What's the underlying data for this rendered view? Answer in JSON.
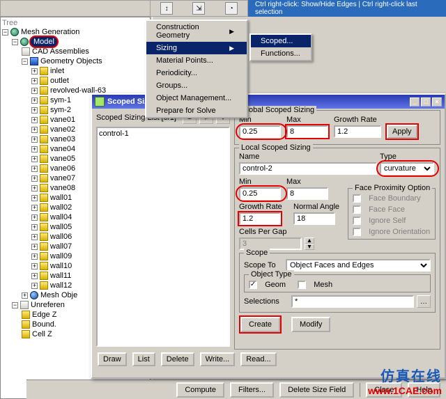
{
  "toolbar": {
    "hint": "Ctrl right-click: Show/Hide Edges | Ctrl right-click last selection"
  },
  "tree": {
    "title": "Tree",
    "root": "Mesh Generation",
    "model": "Model",
    "cad": "CAD Assemblies",
    "geom": "Geometry Objects",
    "items": [
      "inlet",
      "outlet",
      "revolved-wall-63",
      "sym-1",
      "sym-2",
      "vane01",
      "vane02",
      "vane03",
      "vane04",
      "vane05",
      "vane06",
      "vane07",
      "vane08",
      "wall01",
      "wall02",
      "wall04",
      "wall05",
      "wall06",
      "wall07",
      "wall09",
      "wall10",
      "wall11",
      "wall12"
    ],
    "mesh_obj": "Mesh Obje",
    "unref": "Unreferen",
    "unref_items": [
      "Edge Z",
      "Bound.",
      "Cell Z"
    ]
  },
  "ctx": {
    "items": [
      {
        "label": "Construction Geometry",
        "arrow": true
      },
      {
        "label": "Sizing",
        "arrow": true,
        "hi": true
      },
      {
        "label": "Material Points..."
      },
      {
        "label": "Periodicity..."
      },
      {
        "label": "Groups..."
      },
      {
        "label": "Object Management..."
      },
      {
        "label": "Prepare for Solve"
      }
    ],
    "sub": [
      {
        "label": "Scoped...",
        "hi": true
      },
      {
        "label": "Functions..."
      }
    ]
  },
  "dialog": {
    "title": "Scoped Sizing",
    "list_header": "Scoped Sizing List [0/1]",
    "list_items": [
      "control-1"
    ],
    "global": {
      "legend": "Global Scoped Sizing",
      "min_lbl": "Min",
      "min": "0.25",
      "max_lbl": "Max",
      "max": "8",
      "gr_lbl": "Growth Rate",
      "gr": "1.2",
      "apply": "Apply"
    },
    "local": {
      "legend": "Local Scoped Sizing",
      "name_lbl": "Name",
      "name": "control-2",
      "type_lbl": "Type",
      "type": "curvature",
      "min_lbl": "Min",
      "min": "0.25",
      "max_lbl": "Max",
      "max": "8",
      "gr_lbl": "Growth Rate",
      "gr": "1.2",
      "na_lbl": "Normal Angle",
      "na": "18",
      "cpg_lbl": "Cells Per Gap",
      "cpg": "3",
      "fp_legend": "Face Proximity Option",
      "fb": "Face Boundary",
      "ff": "Face Face",
      "is": "Ignore Self",
      "io": "Ignore Orientation",
      "scope_legend": "Scope",
      "scope_to_lbl": "Scope To",
      "scope_to": "Object Faces and Edges",
      "ot_legend": "Object Type",
      "geom": "Geom",
      "mesh": "Mesh",
      "sel_lbl": "Selections",
      "sel": "*",
      "create": "Create",
      "modify": "Modify"
    },
    "bottom": {
      "draw": "Draw",
      "list": "List",
      "delete": "Delete",
      "write": "Write...",
      "read": "Read..."
    }
  },
  "footer": {
    "compute": "Compute",
    "filters": "Filters...",
    "dsf": "Delete Size Field",
    "close": "Close",
    "help": "Help"
  },
  "wm": {
    "big": "1CAE.",
    "cn": "仿真在线",
    "url": "www.1CAE.com"
  }
}
